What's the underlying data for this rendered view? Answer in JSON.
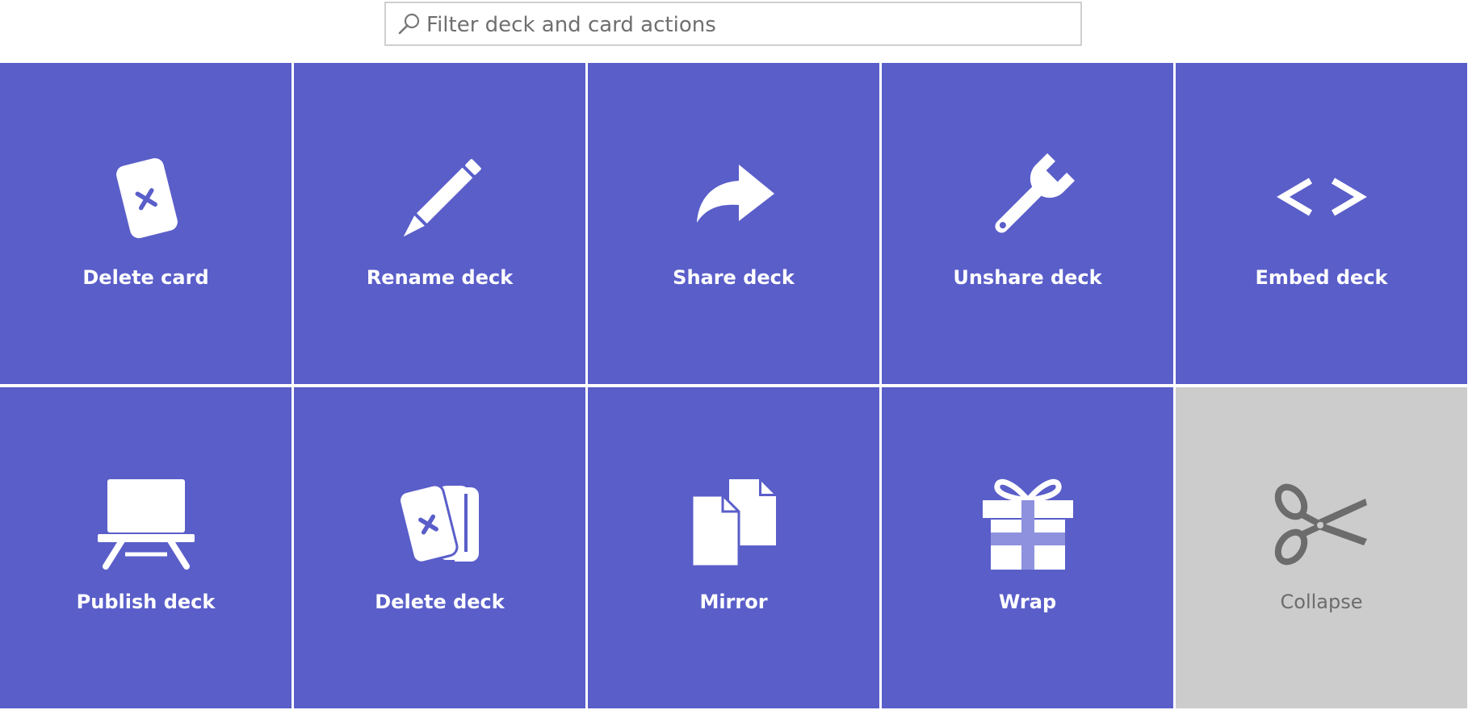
{
  "search": {
    "placeholder": "Filter deck and card actions",
    "value": ""
  },
  "colors": {
    "tile": "#5a5ec9",
    "disabled_tile": "#cccccc",
    "icon": "#ffffff",
    "disabled_icon": "#6c6c6c"
  },
  "actions": [
    {
      "label": "Delete card",
      "icon": "card-delete-icon",
      "enabled": true
    },
    {
      "label": "Rename deck",
      "icon": "pencil-icon",
      "enabled": true
    },
    {
      "label": "Share deck",
      "icon": "share-arrow-icon",
      "enabled": true
    },
    {
      "label": "Unshare deck",
      "icon": "wrench-icon",
      "enabled": true
    },
    {
      "label": "Embed deck",
      "icon": "code-brackets-icon",
      "enabled": true
    },
    {
      "label": "Publish deck",
      "icon": "easel-icon",
      "enabled": true
    },
    {
      "label": "Delete deck",
      "icon": "deck-delete-icon",
      "enabled": true
    },
    {
      "label": "Mirror",
      "icon": "copy-files-icon",
      "enabled": true
    },
    {
      "label": "Wrap",
      "icon": "gift-icon",
      "enabled": true
    },
    {
      "label": "Collapse",
      "icon": "scissors-icon",
      "enabled": false
    }
  ]
}
